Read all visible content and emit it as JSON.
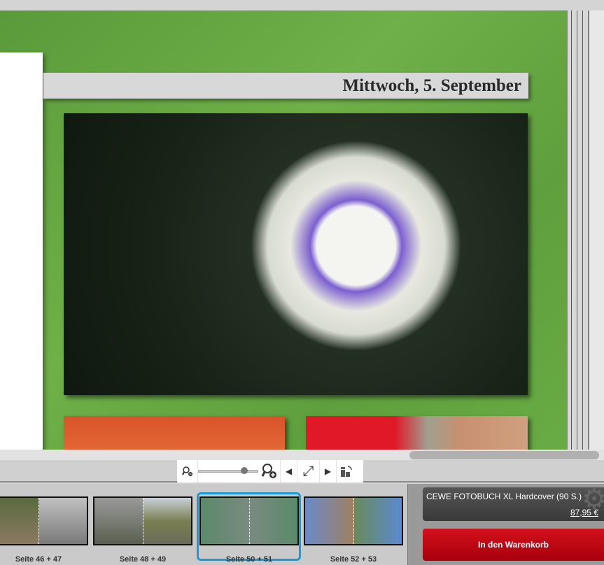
{
  "page": {
    "title": "Mittwoch, 5. September"
  },
  "toolbar": {
    "zoom_out_icon": "zoom-out-icon",
    "zoom_in_icon": "zoom-in-icon",
    "zoom_level": 0.8,
    "prev": "◀",
    "fit": "⤢",
    "next": "▶"
  },
  "filmstrip": {
    "items": [
      {
        "label": "Seite 46 + 47"
      },
      {
        "label": "Seite 48 + 49"
      },
      {
        "label": "Seite 50 + 51",
        "selected": true
      },
      {
        "label": "Seite 52 + 53"
      }
    ]
  },
  "product": {
    "name": "CEWE FOTOBUCH XL Hardcover  (90 S.)",
    "price": "87,95 €"
  },
  "cart": {
    "label": "In den Warenkorb"
  },
  "colors": {
    "accent": "#1a9ad6",
    "cart": "#c00010",
    "page_bg": "#64a640"
  }
}
